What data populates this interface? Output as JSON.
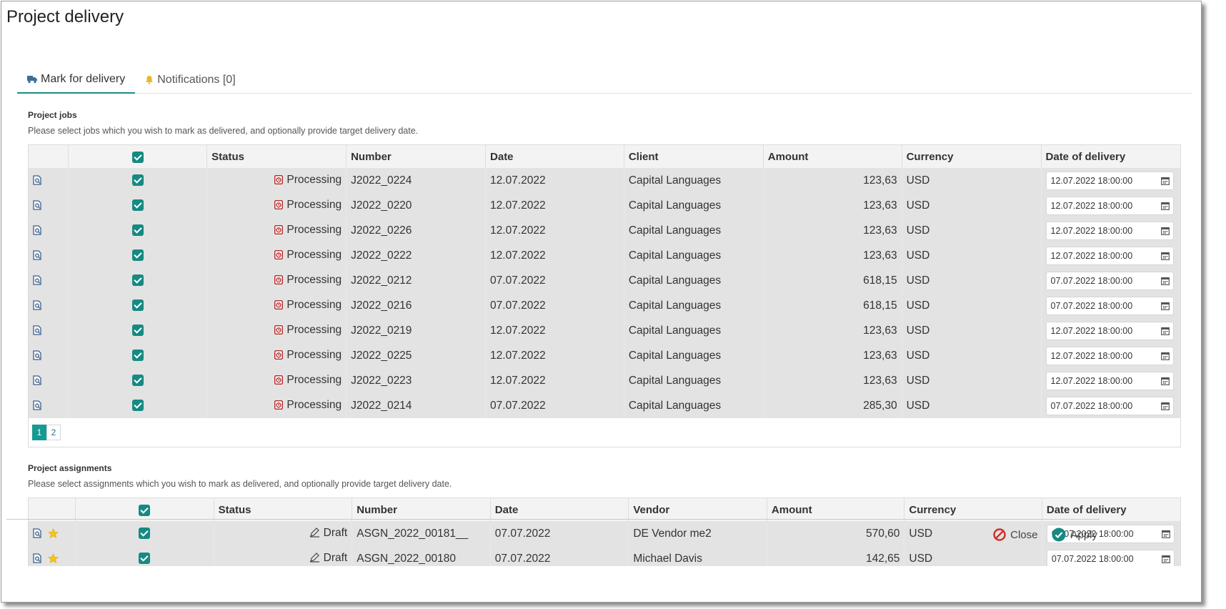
{
  "title": "Project delivery",
  "tabs": [
    {
      "label": "Mark for delivery",
      "icon": "truck-icon",
      "active": true
    },
    {
      "label": "Notifications [0]",
      "icon": "bell-icon",
      "active": false
    }
  ],
  "jobs": {
    "title": "Project jobs",
    "description": "Please select jobs which you wish to mark as delivered, and optionally provide target delivery date.",
    "columns": [
      "Status",
      "Number",
      "Date",
      "Client",
      "Amount",
      "Currency",
      "Date of delivery"
    ],
    "rows": [
      {
        "status": "Processing",
        "number": "J2022_0224",
        "date": "12.07.2022",
        "client": "Capital Languages",
        "amount": "123,63",
        "currency": "USD",
        "delivery": "12.07.2022 18:00:00"
      },
      {
        "status": "Processing",
        "number": "J2022_0220",
        "date": "12.07.2022",
        "client": "Capital Languages",
        "amount": "123,63",
        "currency": "USD",
        "delivery": "12.07.2022 18:00:00"
      },
      {
        "status": "Processing",
        "number": "J2022_0226",
        "date": "12.07.2022",
        "client": "Capital Languages",
        "amount": "123,63",
        "currency": "USD",
        "delivery": "12.07.2022 18:00:00"
      },
      {
        "status": "Processing",
        "number": "J2022_0222",
        "date": "12.07.2022",
        "client": "Capital Languages",
        "amount": "123,63",
        "currency": "USD",
        "delivery": "12.07.2022 18:00:00"
      },
      {
        "status": "Processing",
        "number": "J2022_0212",
        "date": "07.07.2022",
        "client": "Capital Languages",
        "amount": "618,15",
        "currency": "USD",
        "delivery": "07.07.2022 18:00:00"
      },
      {
        "status": "Processing",
        "number": "J2022_0216",
        "date": "07.07.2022",
        "client": "Capital Languages",
        "amount": "618,15",
        "currency": "USD",
        "delivery": "07.07.2022 18:00:00"
      },
      {
        "status": "Processing",
        "number": "J2022_0219",
        "date": "12.07.2022",
        "client": "Capital Languages",
        "amount": "123,63",
        "currency": "USD",
        "delivery": "12.07.2022 18:00:00"
      },
      {
        "status": "Processing",
        "number": "J2022_0225",
        "date": "12.07.2022",
        "client": "Capital Languages",
        "amount": "123,63",
        "currency": "USD",
        "delivery": "12.07.2022 18:00:00"
      },
      {
        "status": "Processing",
        "number": "J2022_0223",
        "date": "12.07.2022",
        "client": "Capital Languages",
        "amount": "123,63",
        "currency": "USD",
        "delivery": "12.07.2022 18:00:00"
      },
      {
        "status": "Processing",
        "number": "J2022_0214",
        "date": "07.07.2022",
        "client": "Capital Languages",
        "amount": "285,30",
        "currency": "USD",
        "delivery": "07.07.2022 18:00:00"
      }
    ],
    "pages": [
      "1",
      "2"
    ],
    "active_page": "1"
  },
  "assignments": {
    "title": "Project assignments",
    "description": "Please select assignments which you wish to mark as delivered, and optionally provide target delivery date.",
    "columns": [
      "Status",
      "Number",
      "Date",
      "Vendor",
      "Amount",
      "Currency",
      "Date of delivery"
    ],
    "rows": [
      {
        "status": "Draft",
        "number": "ASGN_2022_00181__",
        "date": "07.07.2022",
        "vendor": "DE Vendor me2",
        "amount": "570,60",
        "currency": "USD",
        "delivery": "07.07.2022 18:00:00"
      },
      {
        "status": "Draft",
        "number": "ASGN_2022_00180",
        "date": "07.07.2022",
        "vendor": "Michael Davis",
        "amount": "142,65",
        "currency": "USD",
        "delivery": "07.07.2022 18:00:00"
      }
    ]
  },
  "footer": {
    "close_label": "Close",
    "apply_label": "Apply"
  },
  "colors": {
    "accent": "#168a82",
    "status_processing": "#c0392b",
    "star": "#f5c518"
  }
}
